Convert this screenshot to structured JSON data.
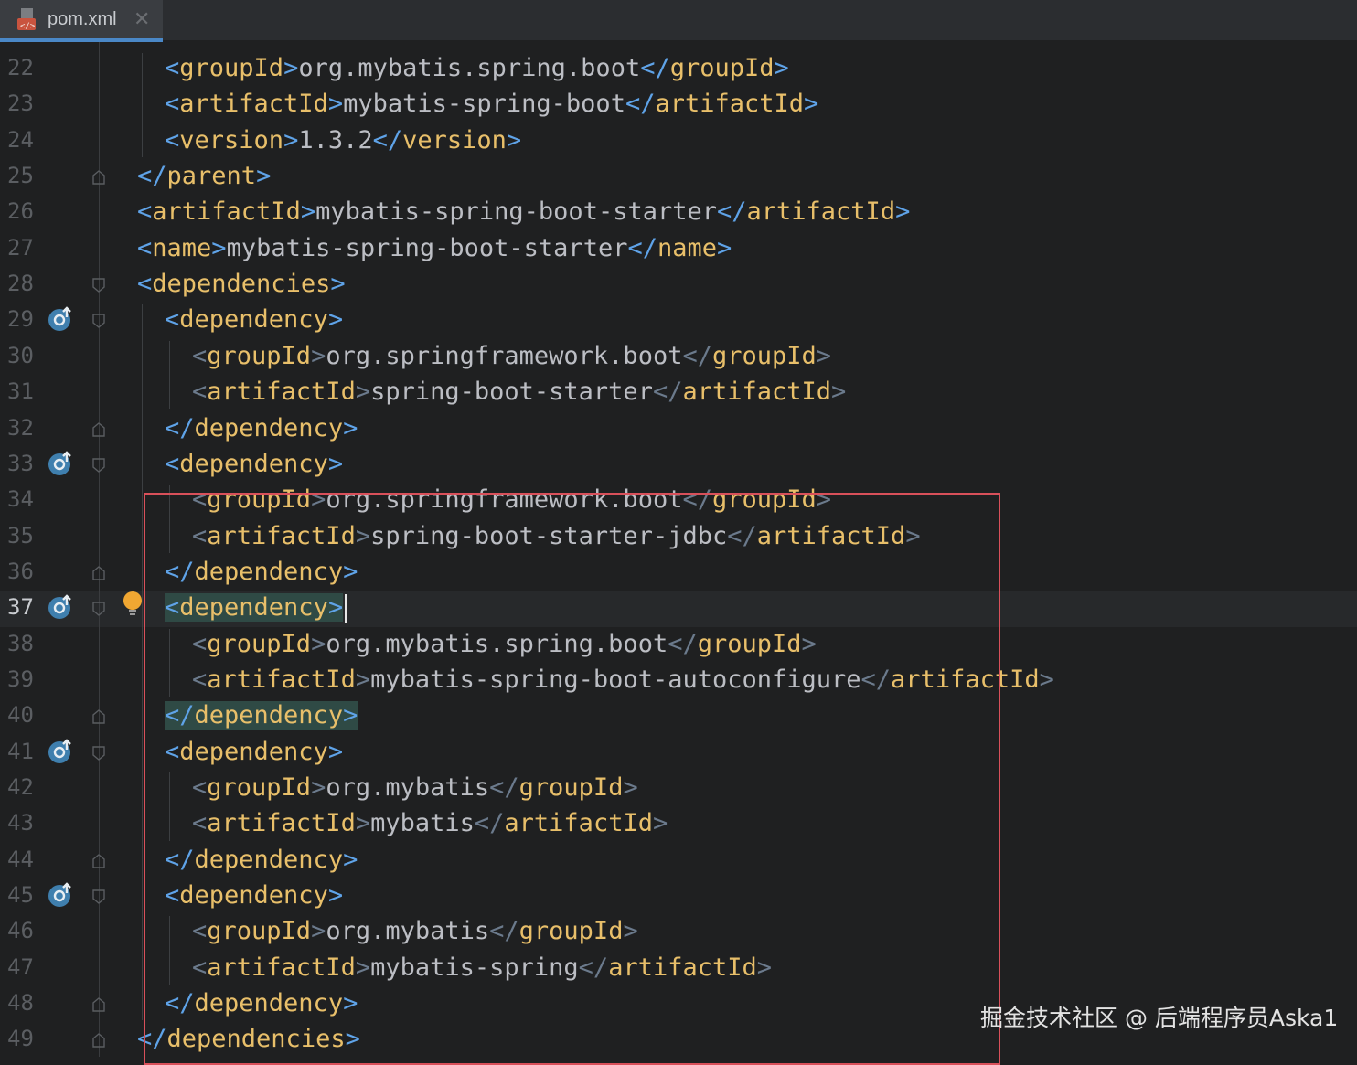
{
  "tab": {
    "filename": "pom.xml",
    "close": "✕"
  },
  "colors": {
    "tag": "#e8bf6a",
    "bracket": "#5fa3e8",
    "text": "#bcbec4",
    "highlight_box": "#d9505a"
  },
  "current_line": "37",
  "lines": [
    {
      "n": "22",
      "indent": 1,
      "tag": "groupId",
      "text": "org.mybatis.spring.boot",
      "type": "full"
    },
    {
      "n": "23",
      "indent": 1,
      "tag": "artifactId",
      "text": "mybatis-spring-boot",
      "type": "full"
    },
    {
      "n": "24",
      "indent": 1,
      "tag": "version",
      "text": "1.3.2",
      "type": "full"
    },
    {
      "n": "25",
      "indent": 0,
      "tag": "parent",
      "type": "close"
    },
    {
      "n": "26",
      "indent": 0,
      "tag": "artifactId",
      "text": "mybatis-spring-boot-starter",
      "type": "full"
    },
    {
      "n": "27",
      "indent": 0,
      "tag": "name",
      "text": "mybatis-spring-boot-starter",
      "type": "full"
    },
    {
      "n": "28",
      "indent": 0,
      "tag": "dependencies",
      "type": "open"
    },
    {
      "n": "29",
      "indent": 1,
      "tag": "dependency",
      "type": "open"
    },
    {
      "n": "30",
      "indent": 2,
      "tag": "groupId",
      "text": "org.springframework.boot",
      "type": "full"
    },
    {
      "n": "31",
      "indent": 2,
      "tag": "artifactId",
      "text": "spring-boot-starter",
      "type": "full"
    },
    {
      "n": "32",
      "indent": 1,
      "tag": "dependency",
      "type": "close"
    },
    {
      "n": "33",
      "indent": 1,
      "tag": "dependency",
      "type": "open"
    },
    {
      "n": "34",
      "indent": 2,
      "tag": "groupId",
      "text": "org.springframework.boot",
      "type": "full"
    },
    {
      "n": "35",
      "indent": 2,
      "tag": "artifactId",
      "text": "spring-boot-starter-jdbc",
      "type": "full"
    },
    {
      "n": "36",
      "indent": 1,
      "tag": "dependency",
      "type": "close"
    },
    {
      "n": "37",
      "indent": 1,
      "tag": "dependency",
      "type": "open"
    },
    {
      "n": "38",
      "indent": 2,
      "tag": "groupId",
      "text": "org.mybatis.spring.boot",
      "type": "full"
    },
    {
      "n": "39",
      "indent": 2,
      "tag": "artifactId",
      "text": "mybatis-spring-boot-autoconfigure",
      "type": "full"
    },
    {
      "n": "40",
      "indent": 1,
      "tag": "dependency",
      "type": "close"
    },
    {
      "n": "41",
      "indent": 1,
      "tag": "dependency",
      "type": "open"
    },
    {
      "n": "42",
      "indent": 2,
      "tag": "groupId",
      "text": "org.mybatis",
      "type": "full"
    },
    {
      "n": "43",
      "indent": 2,
      "tag": "artifactId",
      "text": "mybatis",
      "type": "full"
    },
    {
      "n": "44",
      "indent": 1,
      "tag": "dependency",
      "type": "close"
    },
    {
      "n": "45",
      "indent": 1,
      "tag": "dependency",
      "type": "open"
    },
    {
      "n": "46",
      "indent": 2,
      "tag": "groupId",
      "text": "org.mybatis",
      "type": "full"
    },
    {
      "n": "47",
      "indent": 2,
      "tag": "artifactId",
      "text": "mybatis-spring",
      "type": "full"
    },
    {
      "n": "48",
      "indent": 1,
      "tag": "dependency",
      "type": "close"
    },
    {
      "n": "49",
      "indent": 0,
      "tag": "dependencies",
      "type": "close"
    }
  ],
  "gutter_icons": {
    "maven_lines": [
      "29",
      "33",
      "37",
      "41",
      "45"
    ],
    "intention_bulb_line": "37"
  },
  "watermark": "掘金技术社区 @ 后端程序员Aska1"
}
